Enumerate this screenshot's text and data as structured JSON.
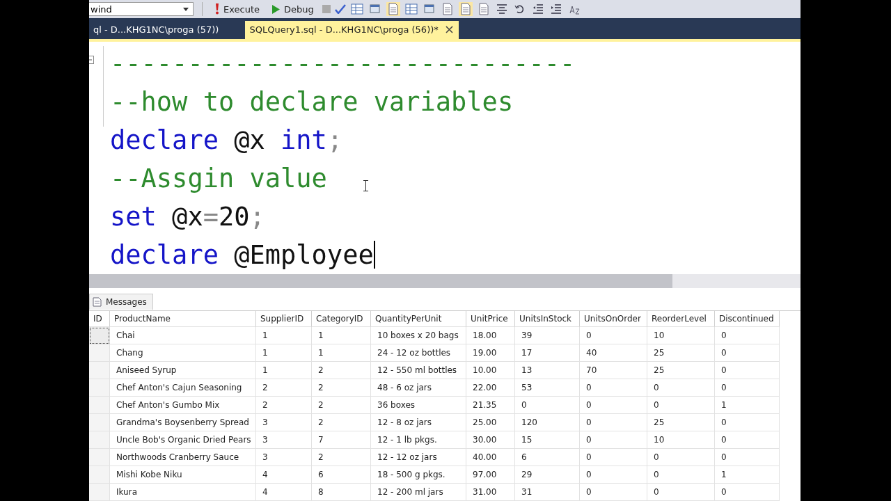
{
  "toolbar": {
    "database_dropdown": "wind",
    "execute": "Execute",
    "debug": "Debug"
  },
  "tabs": [
    {
      "label": "ql - D...KHG1NC\\proga (57))",
      "selected": false,
      "closable": false
    },
    {
      "label": "SQLQuery1.sql - D...KHG1NC\\proga (56))*",
      "selected": true,
      "closable": true
    }
  ],
  "editor": {
    "lines": [
      {
        "fold": true,
        "caret": false,
        "tokens": [
          {
            "kind": "comment",
            "text": "------------------------------"
          }
        ]
      },
      {
        "fold": false,
        "caret": false,
        "tokens": [
          {
            "kind": "comment",
            "text": "--how to declare variables"
          }
        ]
      },
      {
        "fold": false,
        "caret": false,
        "tokens": [
          {
            "kind": "keyword",
            "text": "declare"
          },
          {
            "kind": "plain",
            "text": " @x "
          },
          {
            "kind": "keyword",
            "text": "int"
          },
          {
            "kind": "operator",
            "text": ";"
          }
        ]
      },
      {
        "fold": false,
        "caret": false,
        "tokens": [
          {
            "kind": "comment",
            "text": "--Assgin value"
          }
        ]
      },
      {
        "fold": false,
        "caret": false,
        "tokens": [
          {
            "kind": "keyword",
            "text": "set"
          },
          {
            "kind": "plain",
            "text": " @x"
          },
          {
            "kind": "operator",
            "text": "="
          },
          {
            "kind": "plain",
            "text": "20"
          },
          {
            "kind": "operator",
            "text": ";"
          }
        ]
      },
      {
        "fold": false,
        "caret": true,
        "tokens": [
          {
            "kind": "keyword",
            "text": "declare"
          },
          {
            "kind": "plain",
            "text": " @Employee"
          }
        ]
      }
    ]
  },
  "results": {
    "tab": "Messages",
    "columns": [
      "ID",
      "ProductName",
      "SupplierID",
      "CategoryID",
      "QuantityPerUnit",
      "UnitPrice",
      "UnitsInStock",
      "UnitsOnOrder",
      "ReorderLevel",
      "Discontinued"
    ],
    "rows": [
      {
        "selected": true,
        "cells": [
          "",
          "Chai",
          "1",
          "1",
          "10 boxes x 20 bags",
          "18.00",
          "39",
          "0",
          "10",
          "0"
        ]
      },
      {
        "selected": false,
        "cells": [
          "",
          "Chang",
          "1",
          "1",
          "24 - 12 oz bottles",
          "19.00",
          "17",
          "40",
          "25",
          "0"
        ]
      },
      {
        "selected": false,
        "cells": [
          "",
          "Aniseed Syrup",
          "1",
          "2",
          "12 - 550 ml bottles",
          "10.00",
          "13",
          "70",
          "25",
          "0"
        ]
      },
      {
        "selected": false,
        "cells": [
          "",
          "Chef Anton's Cajun Seasoning",
          "2",
          "2",
          "48 - 6 oz jars",
          "22.00",
          "53",
          "0",
          "0",
          "0"
        ]
      },
      {
        "selected": false,
        "cells": [
          "",
          "Chef Anton's Gumbo Mix",
          "2",
          "2",
          "36 boxes",
          "21.35",
          "0",
          "0",
          "0",
          "1"
        ]
      },
      {
        "selected": false,
        "cells": [
          "",
          "Grandma's Boysenberry Spread",
          "3",
          "2",
          "12 - 8 oz jars",
          "25.00",
          "120",
          "0",
          "25",
          "0"
        ]
      },
      {
        "selected": false,
        "cells": [
          "",
          "Uncle Bob's Organic Dried Pears",
          "3",
          "7",
          "12 - 1 lb pkgs.",
          "30.00",
          "15",
          "0",
          "10",
          "0"
        ]
      },
      {
        "selected": false,
        "cells": [
          "",
          "Northwoods Cranberry Sauce",
          "3",
          "2",
          "12 - 12 oz jars",
          "40.00",
          "6",
          "0",
          "0",
          "0"
        ]
      },
      {
        "selected": false,
        "cells": [
          "",
          "Mishi Kobe Niku",
          "4",
          "6",
          "18 - 500 g pkgs.",
          "97.00",
          "29",
          "0",
          "0",
          "1"
        ]
      },
      {
        "selected": false,
        "cells": [
          "",
          "Ikura",
          "4",
          "8",
          "12 - 200 ml jars",
          "31.00",
          "31",
          "0",
          "0",
          "0"
        ]
      }
    ]
  }
}
